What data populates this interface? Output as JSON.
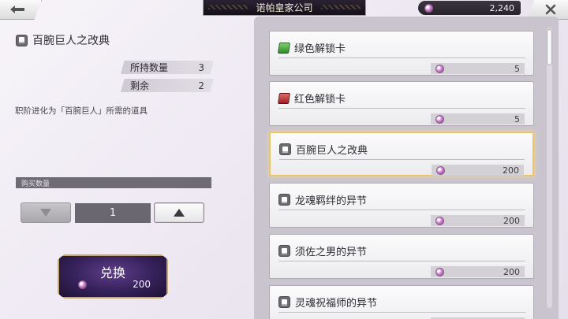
{
  "header": {
    "title": "诺帕皇家公司",
    "currency_value": "2,240",
    "back_icon": "back-arrow-icon",
    "close_icon": "close-icon"
  },
  "detail": {
    "item_name": "百腕巨人之改典",
    "owned_label": "所持数量",
    "owned_value": "3",
    "remaining_label": "剩余",
    "remaining_value": "2",
    "description": "职阶进化为「百腕巨人」所需的道具"
  },
  "purchase": {
    "qty_header": "购买数量",
    "quantity": "1",
    "exchange_label": "兑换",
    "exchange_cost": "200"
  },
  "shop_items": [
    {
      "name": "绿色解锁卡",
      "price": "5",
      "icon": "green-card-icon"
    },
    {
      "name": "红色解锁卡",
      "price": "5",
      "icon": "red-card-icon"
    },
    {
      "name": "百腕巨人之改典",
      "price": "200",
      "icon": "book-icon",
      "selected": true
    },
    {
      "name": "龙魂羁绊的异节",
      "price": "200",
      "icon": "book-icon"
    },
    {
      "name": "须佐之男的异节",
      "price": "200",
      "icon": "book-icon"
    },
    {
      "name": "灵魂祝福师的异节",
      "price": "200",
      "icon": "book-icon"
    }
  ],
  "colors": {
    "selected_border": "#e9c46a",
    "exchange_bg": "#35215a",
    "gold_trim": "#c8a96a"
  }
}
